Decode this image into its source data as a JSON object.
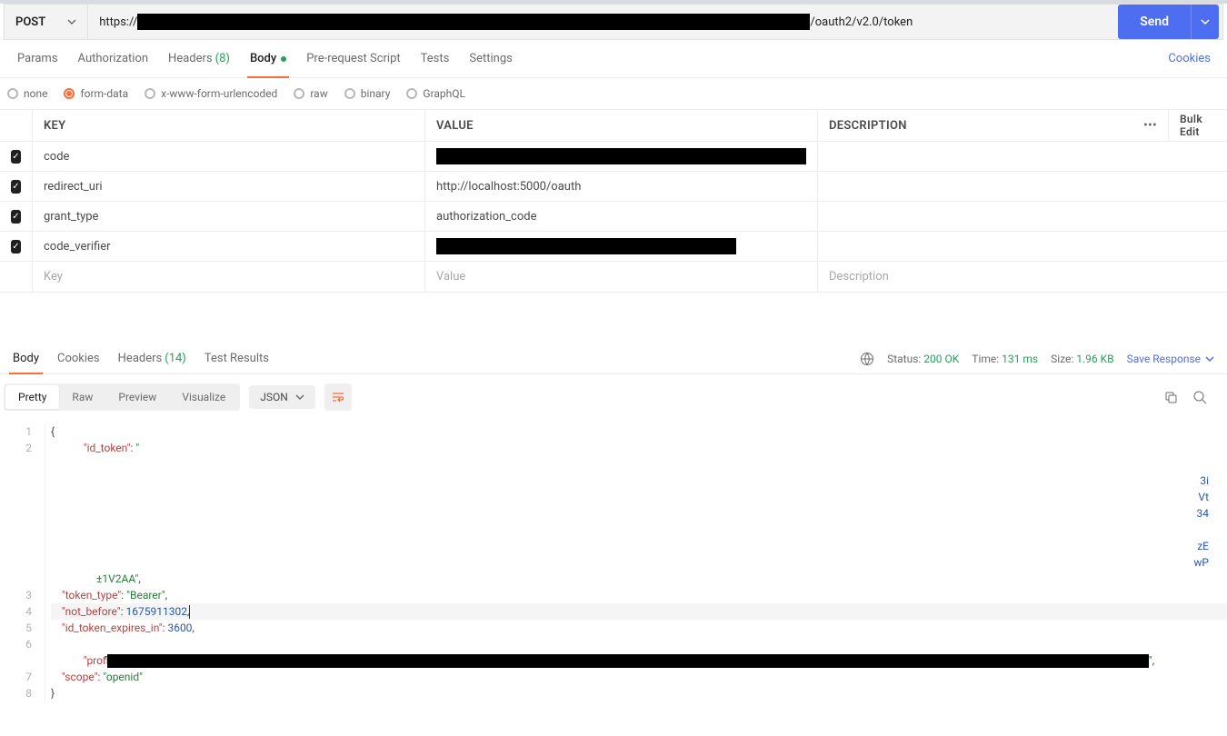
{
  "request": {
    "method": "POST",
    "url_prefix": "https://",
    "url_suffix": "/oauth2/v2.0/token",
    "send_label": "Send"
  },
  "tabs": {
    "params": "Params",
    "authorization": "Authorization",
    "headers": "Headers",
    "headers_count": "(8)",
    "body": "Body",
    "prerequest": "Pre-request Script",
    "tests": "Tests",
    "settings": "Settings",
    "cookies": "Cookies"
  },
  "body_types": [
    "none",
    "form-data",
    "x-www-form-urlencoded",
    "raw",
    "binary",
    "GraphQL"
  ],
  "selected_body_type": "form-data",
  "kv": {
    "header_key": "KEY",
    "header_value": "VALUE",
    "header_desc": "DESCRIPTION",
    "bulk_edit": "Bulk Edit",
    "placeholder_key": "Key",
    "placeholder_value": "Value",
    "placeholder_desc": "Description",
    "rows": [
      {
        "key": "code",
        "value": "",
        "redacted": true
      },
      {
        "key": "redirect_uri",
        "value": "http://localhost:5000/oauth",
        "redacted": false
      },
      {
        "key": "grant_type",
        "value": "authorization_code",
        "redacted": false
      },
      {
        "key": "code_verifier",
        "value": "",
        "redacted": true
      }
    ]
  },
  "response_tabs": {
    "body": "Body",
    "cookies": "Cookies",
    "headers": "Headers",
    "headers_count": "(14)",
    "test_results": "Test Results"
  },
  "response_meta": {
    "status_label": "Status:",
    "status_value": "200 OK",
    "time_label": "Time:",
    "time_value": "131 ms",
    "size_label": "Size:",
    "size_value": "1.96 KB",
    "save": "Save Response"
  },
  "view_tabs": [
    "Pretty",
    "Raw",
    "Preview",
    "Visualize"
  ],
  "lang": "JSON",
  "code": {
    "line1": "{",
    "line2_key": "\"id_token\"",
    "line2_colon": ": ",
    "line2_str": "\"",
    "line2_end_fragment": "±1V2AA\"",
    "right_tokens": [
      "3i",
      "Vt",
      "34",
      "zE",
      "wP"
    ],
    "line3_key": "\"token_type\"",
    "line3_val": "\"Bearer\"",
    "line4_key": "\"not_before\"",
    "line4_val": "1675911302",
    "line5_key": "\"id_token_expires_in\"",
    "line5_val": "3600",
    "line6_key": "\"profile_info\"",
    "line7_key": "\"scope\"",
    "line7_val": "\"openid\"",
    "line8": "}"
  }
}
